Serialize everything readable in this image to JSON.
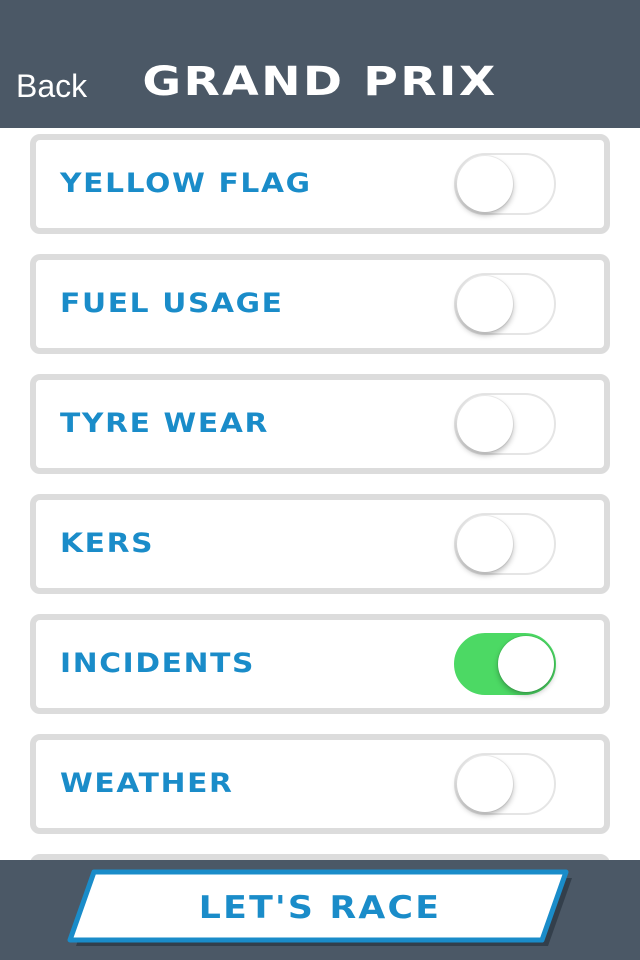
{
  "header": {
    "back_label": "Back",
    "title": "GRAND PRIX",
    "background": "#4b5866"
  },
  "settings": [
    {
      "label": "YELLOW FLAG",
      "enabled": false
    },
    {
      "label": "FUEL USAGE",
      "enabled": false
    },
    {
      "label": "TYRE WEAR",
      "enabled": false
    },
    {
      "label": "KERS",
      "enabled": false
    },
    {
      "label": "INCIDENTS",
      "enabled": true
    },
    {
      "label": "WEATHER",
      "enabled": false
    }
  ],
  "footer": {
    "race_label": "LET'S RACE"
  },
  "colors": {
    "accent": "#1a8cc9",
    "toggle_on": "#4cd964",
    "row_border": "#dcdcdc"
  }
}
